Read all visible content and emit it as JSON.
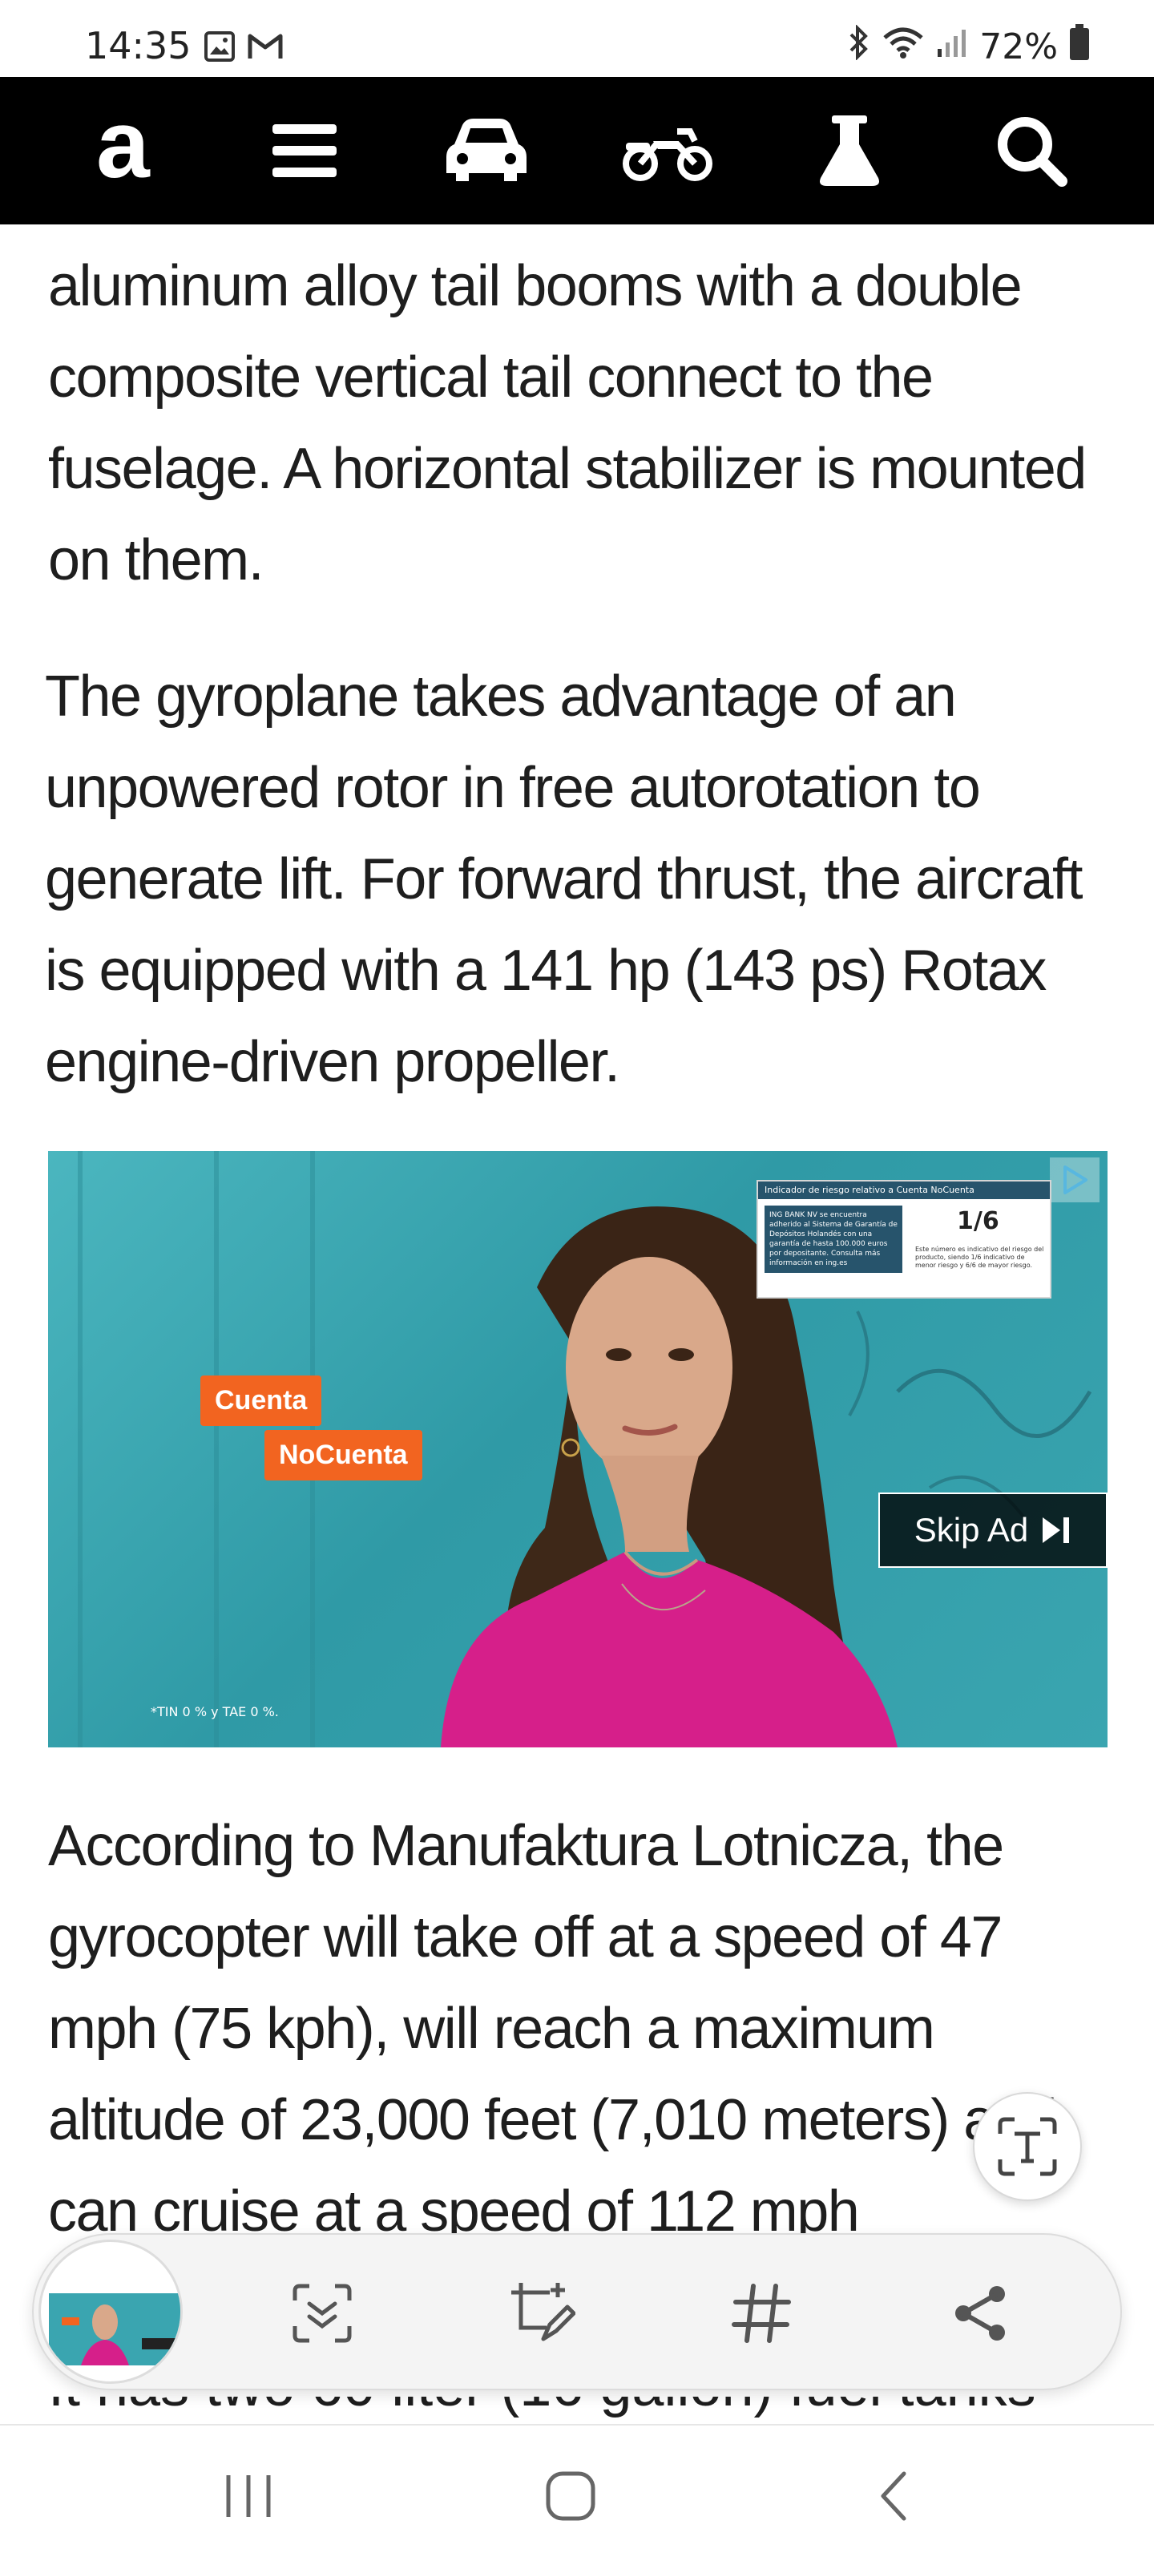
{
  "status_bar": {
    "time": "14:35",
    "battery": "72%",
    "icons": [
      "image-icon",
      "gmail-icon",
      "bluetooth-icon",
      "wifi-icon",
      "signal-icon",
      "battery-icon"
    ]
  },
  "top_nav": {
    "logo": "a",
    "items": [
      "menu-icon",
      "car-icon",
      "motorcycle-icon",
      "flask-icon",
      "search-icon"
    ]
  },
  "article": {
    "p1": "aluminum alloy tail booms with a double composite vertical tail connect to the fuselage. A horizontal stabilizer is mounted on them.",
    "p2": "The gyroplane takes advantage of an unpowered rotor in free autorotation to generate lift. For forward thrust, the aircraft is equipped with a 141 hp (143 ps) Rotax engine-driven propeller.",
    "p3": "According to Manufaktura Lotnicza, the gyrocopter will take off at a speed of 47 mph (75 kph), will reach a maximum altitude of 23,000 feet (7,010 meters) and can cruise at a speed of 112 mph",
    "peek": "It has two 60 liter (16 gallon) fuel tanks"
  },
  "ad": {
    "tag1": "Cuenta",
    "tag2": "NoCuenta",
    "skip_label": "Skip Ad",
    "info_head": "Indicador de riesgo relativo a Cuenta NoCuenta",
    "info_left": "ING BANK NV se encuentra adherido al Sistema de Garantía de Depósitos Holandés con una garantía de hasta 100.000 euros por depositante. Consulta más información en ing.es",
    "info_fraction": "1/6",
    "info_note": "Este número es indicativo del riesgo del producto, siendo 1/6 indicativo de menor riesgo y 6/6 de mayor riesgo.",
    "legal": "*TIN 0 % y TAE 0 %.",
    "colors": {
      "tag": "#f26420",
      "bg": "#3fa9b3",
      "shirt": "#d61f8a"
    }
  },
  "toolbar": {
    "tools": [
      "scan-text-icon",
      "crop-edit-icon",
      "hashtag-icon",
      "share-icon"
    ]
  },
  "system_nav": [
    "recents-button",
    "home-button",
    "back-button"
  ]
}
